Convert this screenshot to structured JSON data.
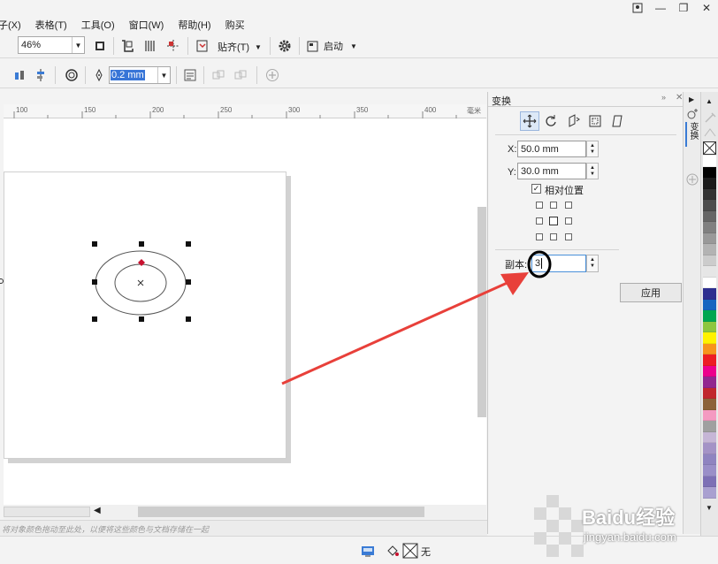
{
  "menu": [
    "子(X)",
    "表格(T)",
    "工具(O)",
    "窗口(W)",
    "帮助(H)",
    "购买"
  ],
  "toolbar1": {
    "zoom_value": "46%",
    "snap_label": "贴齐(T)",
    "launch_label": "启动"
  },
  "toolbar2": {
    "outline_width": "0.2 mm"
  },
  "ruler": {
    "ticks": [
      "100",
      "150",
      "200",
      "250",
      "300",
      "350",
      "400",
      "毫米"
    ]
  },
  "docker": {
    "title": "变换",
    "x_label": "X:",
    "x_value": "50.0 mm",
    "y_label": "Y:",
    "y_value": "30.0 mm",
    "relative_position_label": "相对位置",
    "relative_position_checked": true,
    "copies_label": "副本:",
    "copies_value": "3",
    "apply_label": "应用"
  },
  "side_tab": {
    "label": "变换"
  },
  "status": {
    "hint": "将对象颜色拖动至此处，以便将这些颜色与文档存储在一起",
    "fill_none_label": "无"
  },
  "palette_colors": [
    "#ffffff",
    "#000000",
    "#1a1a1a",
    "#333333",
    "#4d4d4d",
    "#666666",
    "#808080",
    "#999999",
    "#b3b3b3",
    "#cccccc",
    "#e6e6e6",
    "#ffffff",
    "#2e2f8f",
    "#1565c0",
    "#00a651",
    "#8dc63f",
    "#fff200",
    "#f7941d",
    "#ed1c24",
    "#ec008c",
    "#92278f",
    "#c1272d",
    "#8c6239",
    "#f49ac1",
    "#a0a0a0",
    "#c6b6d6",
    "#a493c6",
    "#8f84c0",
    "#9a8fc8",
    "#7d70b5",
    "#a9a0d0"
  ],
  "accent": {
    "arrow": "#e8403a",
    "selection_marker": "#c8102e",
    "annotation_circle": "#000000"
  },
  "watermark": {
    "brand": "Baidu经验",
    "url": "jingyan.baidu.com"
  }
}
